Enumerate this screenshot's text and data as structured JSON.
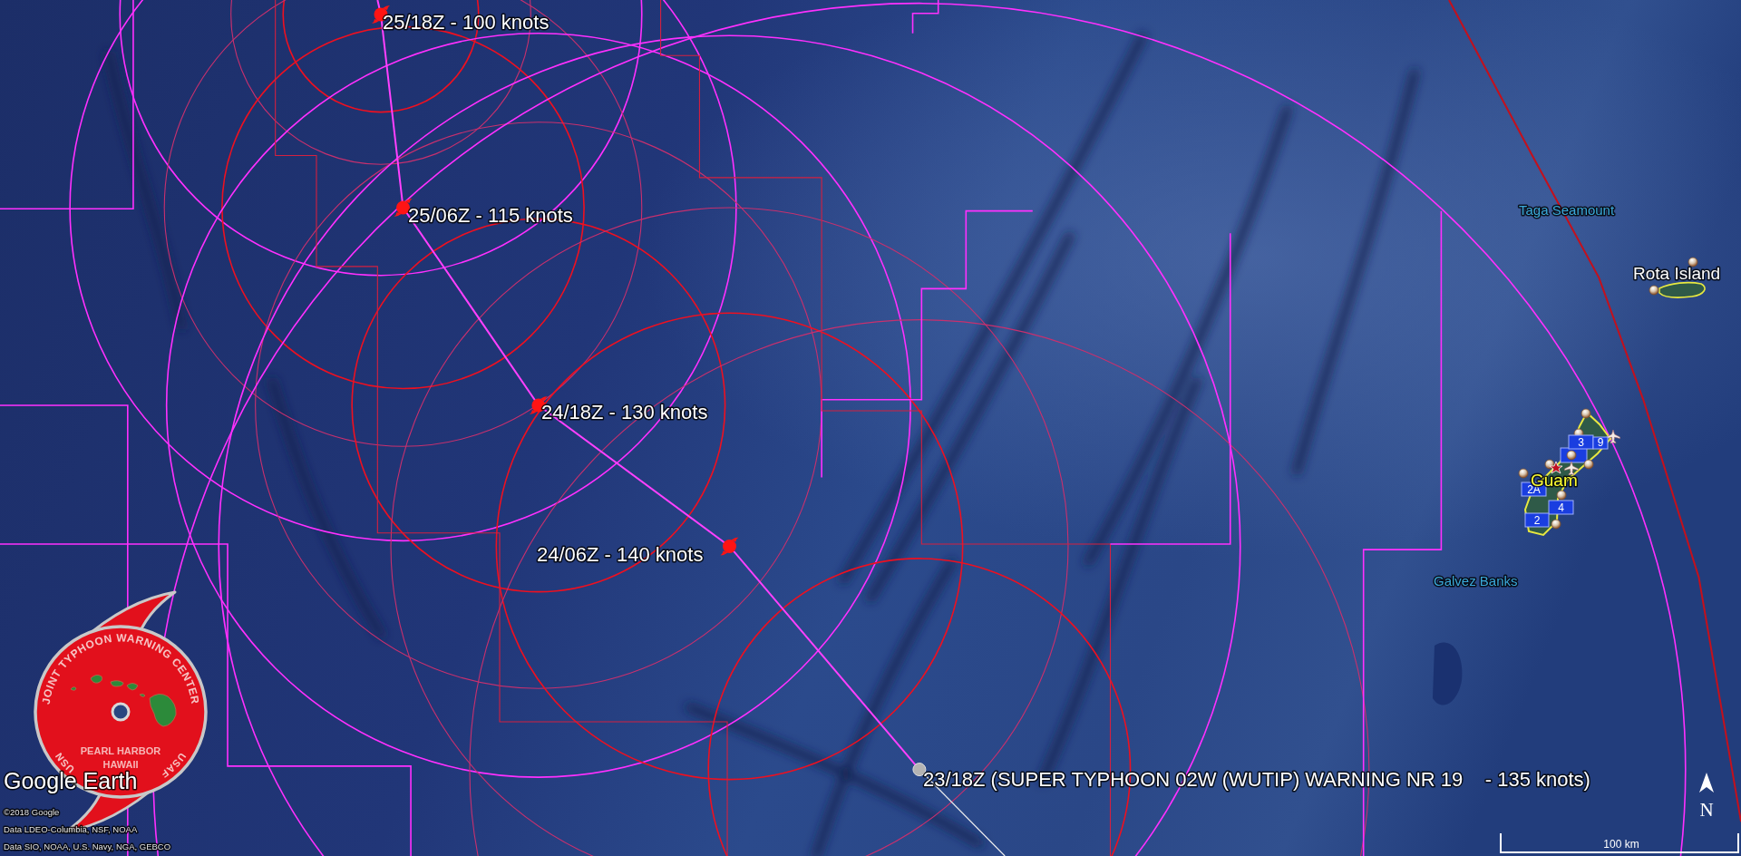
{
  "map": {
    "track_points": [
      {
        "kind": "forecast",
        "label": "25/18Z - 100 knots"
      },
      {
        "kind": "forecast",
        "label": "25/06Z - 115 knots"
      },
      {
        "kind": "forecast",
        "label": "24/18Z - 130 knots"
      },
      {
        "kind": "forecast",
        "label": "24/06Z - 140 knots"
      },
      {
        "kind": "current",
        "label": "23/18Z (SUPER TYPHOON 02W (WUTIP) WARNING NR 19    - 135 knots)"
      }
    ],
    "place_labels": [
      {
        "kind": "feature",
        "label": "Taga Seamount"
      },
      {
        "kind": "island",
        "label": "Rota Island"
      },
      {
        "kind": "major",
        "label": "Guam"
      },
      {
        "kind": "feature",
        "label": "Galvez Banks"
      }
    ],
    "site_markers": [
      {
        "label": "3"
      },
      {
        "label": "9"
      },
      {
        "label": "2A"
      },
      {
        "label": "4"
      },
      {
        "label": "2"
      }
    ]
  },
  "logo": {
    "arc_text": "JOINT TYPHOON WARNING CENTER",
    "left_text": "USN",
    "right_text": "USAF",
    "center_lines": [
      "PEARL HARBOR",
      "HAWAII"
    ]
  },
  "brand": "Google Earth",
  "credits": [
    "©2018 Google",
    "Data LDEO-Columbia, NSF, NOAA",
    "Data SIO, NOAA, U.S. Navy, NGA, GEBCO"
  ],
  "compass": "N",
  "scale_bar": "100 km"
}
